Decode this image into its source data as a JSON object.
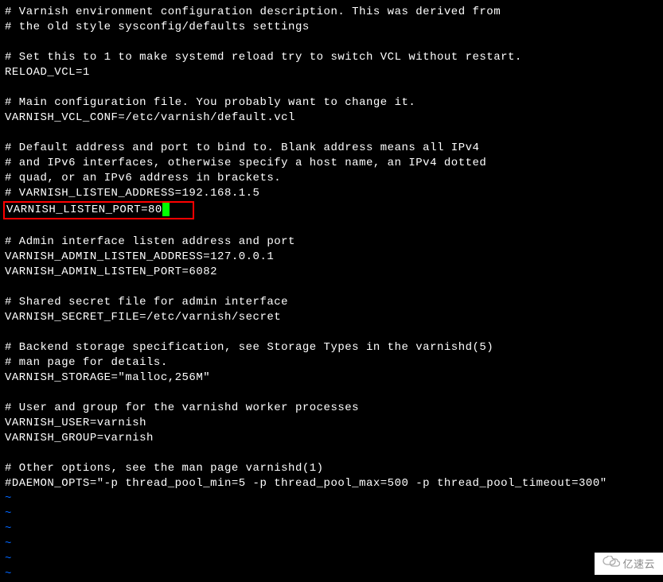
{
  "terminal": {
    "lines": [
      "# Varnish environment configuration description. This was derived from",
      "# the old style sysconfig/defaults settings",
      "",
      "# Set this to 1 to make systemd reload try to switch VCL without restart.",
      "RELOAD_VCL=1",
      "",
      "# Main configuration file. You probably want to change it.",
      "VARNISH_VCL_CONF=/etc/varnish/default.vcl",
      "",
      "# Default address and port to bind to. Blank address means all IPv4",
      "# and IPv6 interfaces, otherwise specify a host name, an IPv4 dotted",
      "# quad, or an IPv6 address in brackets.",
      "# VARNISH_LISTEN_ADDRESS=192.168.1.5"
    ],
    "highlighted_line": "VARNISH_LISTEN_PORT=80",
    "lines_after": [
      "",
      "# Admin interface listen address and port",
      "VARNISH_ADMIN_LISTEN_ADDRESS=127.0.0.1",
      "VARNISH_ADMIN_LISTEN_PORT=6082",
      "",
      "# Shared secret file for admin interface",
      "VARNISH_SECRET_FILE=/etc/varnish/secret",
      "",
      "# Backend storage specification, see Storage Types in the varnishd(5)",
      "# man page for details.",
      "VARNISH_STORAGE=\"malloc,256M\"",
      "",
      "# User and group for the varnishd worker processes",
      "VARNISH_USER=varnish",
      "VARNISH_GROUP=varnish",
      "",
      "# Other options, see the man page varnishd(1)",
      "#DAEMON_OPTS=\"-p thread_pool_min=5 -p thread_pool_max=500 -p thread_pool_timeout=300\""
    ],
    "tildes": [
      "~",
      "~",
      "~",
      "~",
      "~",
      "~"
    ]
  },
  "watermark": {
    "text": "亿速云"
  }
}
